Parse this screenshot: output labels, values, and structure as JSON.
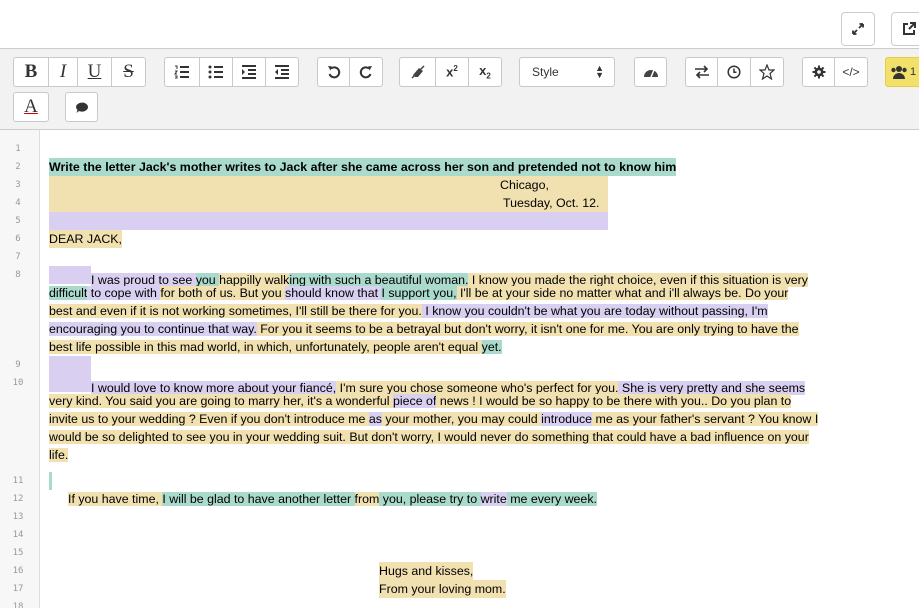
{
  "toolbar": {
    "style_label": "Style",
    "users_badge_count": "1"
  },
  "editor": {
    "line_numbers": [
      "1",
      "2",
      "3",
      "4",
      "5",
      "6",
      "7",
      "8",
      "9",
      "10",
      "11",
      "12",
      "13",
      "14",
      "15",
      "16",
      "17",
      "18"
    ],
    "title_line": "Write the letter Jack's mother writes to Jack after she came across her son and pretended not to know him",
    "place": "Chicago,",
    "date": "Tuesday, Oct. 12.",
    "greeting": "DEAR JACK,",
    "p1": {
      "s1": "I was proud to see ",
      "s2": " you ",
      "s3": "happilly walk",
      "s4": "ing with such a beautiful woman.",
      "s5": " I know you made the right choice, even if this situation is very",
      "s6": "difficult",
      "s7": " to cope with ",
      "s8": "for both of us. But you ",
      "s9": "should know that  ",
      "s10": "I support you,",
      "s11": " I'll be at your side no matter what and i'll always be. Do your",
      "s12": "best and even if it is not working sometimes, I'll still be there for you.",
      "s13": " I know you couldn't be what you are today without passing, I'm",
      "s14": "encouraging you to continue that way.",
      "s15": " For you it seems to be a betrayal but don't worry, it isn't one for me. You are only trying to have the",
      "s16": "best life possible in this mad world, in which, unfortunately, people aren't equal ",
      "s17": "yet."
    },
    "p2": {
      "s1": "I would love to know more about your fiancé,",
      "s2": " I'm sure you chose someone who's perfect for you.",
      "s3": " She is very pretty and she seems",
      "s4": "very kind. You said you are going to marry her, it's a wonderful ",
      "s5": "piece of",
      "s6": " news ! I would be so happy to be there with you.. Do you plan to",
      "s7": "invite us to your wedding ? Even if you don't introduce me ",
      "s8": "as",
      "s9": " your mother, you may could ",
      "s10": "introduce",
      "s11": " me as your father's servant ? You know I",
      "s12": "would  be so delighted to see you in your wedding suit. But don't worry, I would never do something that could have a bad influence on your",
      "s13": "life."
    },
    "p3": {
      "s1": "If you have time, ",
      "s2": "I will be glad to have another letter ",
      "s3": "from",
      "s4": " you, please try to ",
      "s5": "write",
      "s6": " me every week."
    },
    "closing1": "Hugs and kisses,",
    "closing2": "From your loving mom."
  },
  "colors": {
    "highlight_yellow": "#f1e0b0",
    "highlight_green": "#a9dacb",
    "highlight_purple": "#d9d0f1",
    "users_button": "#f3e06a"
  }
}
